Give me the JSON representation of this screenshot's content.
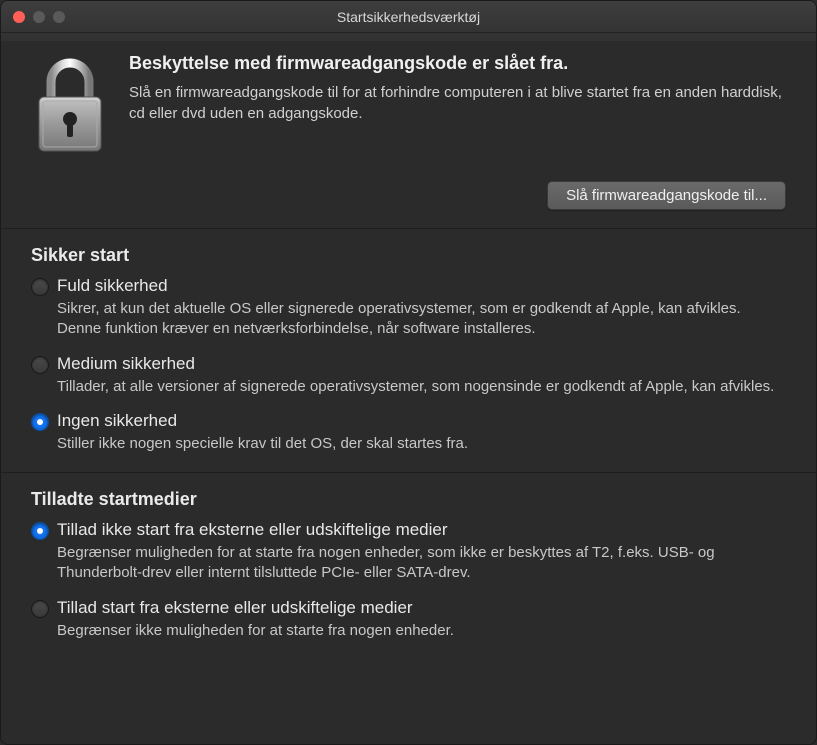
{
  "window": {
    "title": "Startsikkerhedsværktøj"
  },
  "firmware": {
    "heading": "Beskyttelse med firmwareadgangskode er slået fra.",
    "description": "Slå en firmwareadgangskode til for at forhindre computeren i at blive startet fra en anden harddisk, cd eller dvd uden en adgangskode.",
    "button_label": "Slå firmwareadgangskode til..."
  },
  "sections": {
    "secure_boot": {
      "heading": "Sikker start",
      "options": [
        {
          "label": "Fuld sikkerhed",
          "description": "Sikrer, at kun det aktuelle OS eller signerede operativsystemer, som er godkendt af Apple, kan afvikles. Denne funktion kræver en netværksforbindelse, når software installeres.",
          "selected": false
        },
        {
          "label": "Medium sikkerhed",
          "description": "Tillader, at alle versioner af signerede operativsystemer, som nogensinde er godkendt af Apple, kan afvikles.",
          "selected": false
        },
        {
          "label": "Ingen sikkerhed",
          "description": "Stiller ikke nogen specielle krav til det OS, der skal startes fra.",
          "selected": true
        }
      ]
    },
    "allowed_boot": {
      "heading": "Tilladte startmedier",
      "options": [
        {
          "label": "Tillad ikke start fra eksterne eller udskiftelige medier",
          "description": "Begrænser muligheden for at starte fra nogen enheder, som ikke er beskyttes af T2, f.eks. USB- og Thunderbolt-drev eller internt tilsluttede PCIe- eller SATA-drev.",
          "selected": true
        },
        {
          "label": "Tillad start fra eksterne eller udskiftelige medier",
          "description": "Begrænser ikke muligheden for at starte fra nogen enheder.",
          "selected": false
        }
      ]
    }
  }
}
